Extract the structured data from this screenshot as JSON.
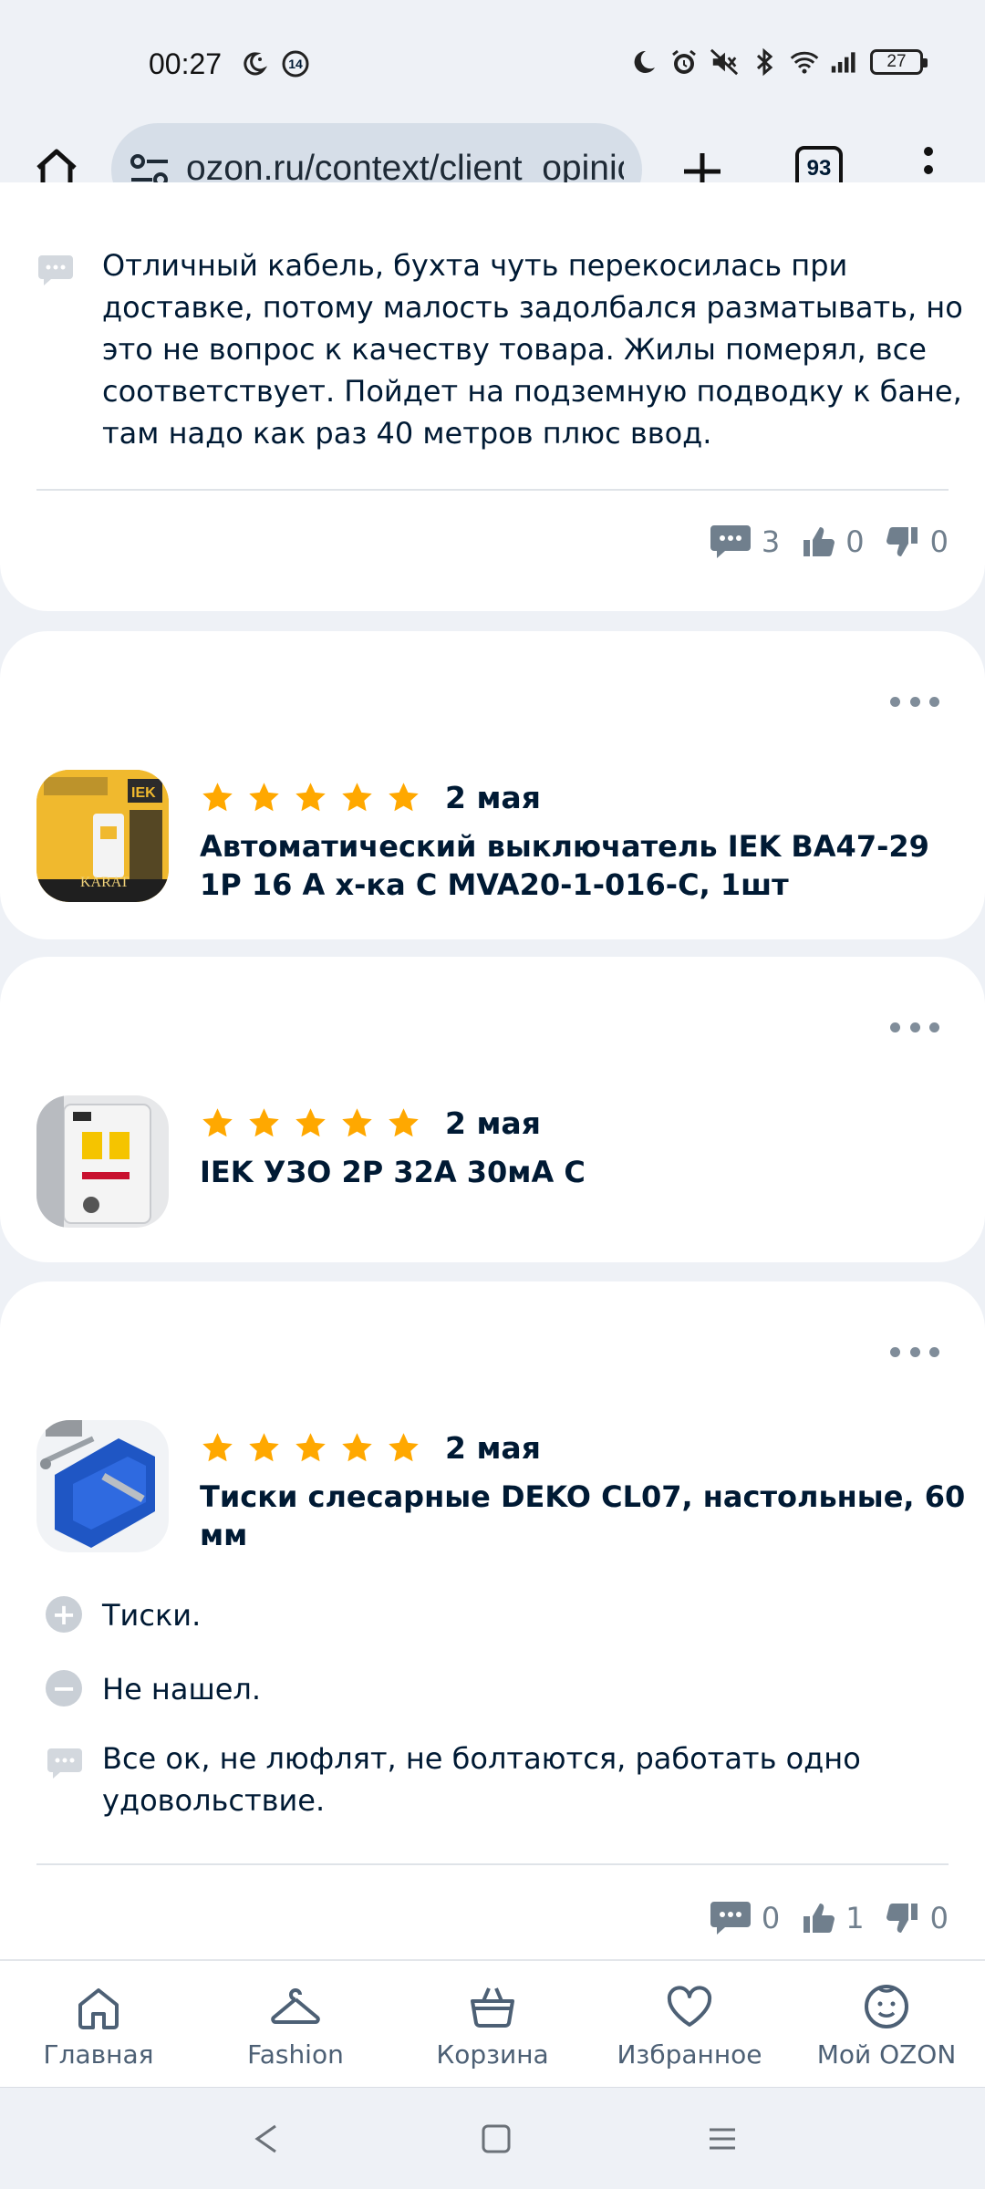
{
  "status_bar": {
    "time": "00:27",
    "notification_count": "14",
    "battery": "27"
  },
  "browser": {
    "url": "ozon.ru/context/client_opinions",
    "tab_count": "93"
  },
  "review_top": {
    "comment": "Отличный кабель, бухта чуть перекосилась при доставке, потому малость задолбался разматывать, но это не вопрос к качеству товара. Жилы померял, все соответствует. Пойдет на подземную подводку к бане, там надо как раз 40 метров плюс ввод.",
    "comments_count": "3",
    "likes": "0",
    "dislikes": "0"
  },
  "reviews": [
    {
      "date": "2 мая",
      "rating": 5,
      "title": "Автоматический выключатель IEK ВА47-29 1P 16 А х-ка С MVA20-1-016-C, 1шт",
      "thumb_label": "KARAT"
    },
    {
      "date": "2 мая",
      "rating": 5,
      "title": "IEK УЗО 2P 32А 30мА С"
    },
    {
      "date": "2 мая",
      "rating": 5,
      "title": "Тиски слесарные DEKO CL07, настольные, 60 мм",
      "pros": "Тиски.",
      "cons": "Не нашел.",
      "comment": "Все ок, не люфлят, не болтаются, работать одно удовольствие.",
      "comments_count": "0",
      "likes": "1",
      "dislikes": "0"
    }
  ],
  "bottom_nav": [
    {
      "label": "Главная"
    },
    {
      "label": "Fashion"
    },
    {
      "label": "Корзина"
    },
    {
      "label": "Избранное"
    },
    {
      "label": "Мой OZON"
    }
  ],
  "colors": {
    "star": "#ffa800",
    "text": "#001a34",
    "muted": "#707f8d",
    "nav_icon": "#4d6075"
  }
}
